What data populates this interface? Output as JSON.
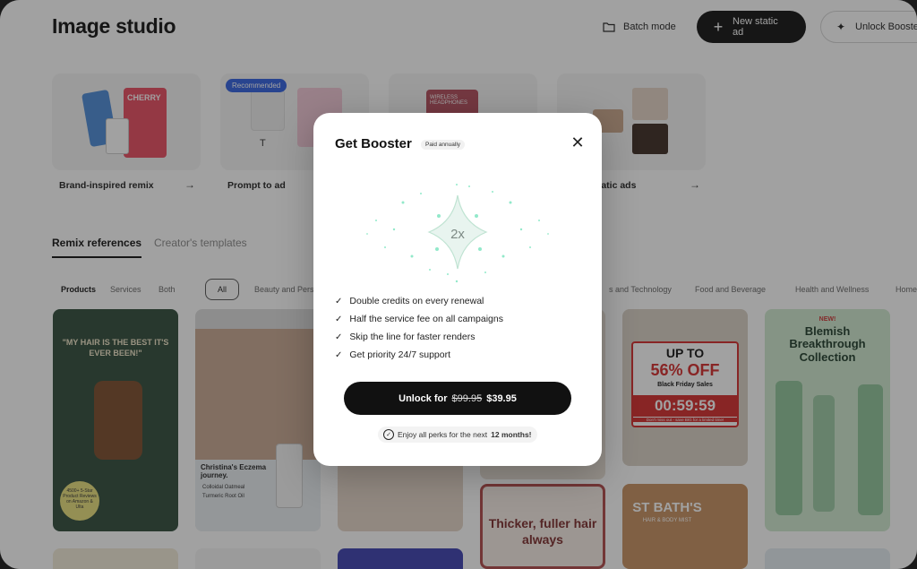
{
  "header": {
    "title": "Image studio",
    "batch_label": "Batch mode",
    "new_ad_label": "New static ad",
    "unlock_label": "Unlock Booster"
  },
  "features": [
    {
      "label": "Brand-inspired remix",
      "thumb_text": "CHERRY"
    },
    {
      "label": "Prompt to ad",
      "badge": "Recommended"
    },
    {
      "label": "",
      "thumb_text": "WIRELESS HEADPHONES"
    },
    {
      "label": "static ads"
    }
  ],
  "tabs": {
    "active": "Remix references",
    "inactive": "Creator's templates"
  },
  "filters": {
    "types": [
      "Products",
      "Services",
      "Both"
    ],
    "all": "All",
    "categories": [
      "Beauty and Pers",
      "s and Technology",
      "Food and Beverage",
      "Health and Wellness",
      "Home"
    ]
  },
  "cards": {
    "hair_quote": "\"MY HAIR IS THE BEST IT'S EVER BEEN!\"",
    "hair_badge": "4500+ 5-Star Product Reviews on Amazon & Ulta",
    "eczema_title": "Christina's Eczema journey.",
    "eczema_items": [
      "Colloidal Oatmeal",
      "Turmeric Root Oil"
    ],
    "bf_up": "UP TO",
    "bf_off": "56% OFF",
    "bf_sale": "Black Friday Sales",
    "bf_timer": "00:59:59",
    "bf_note": "Don't miss out - save BIG for a limited time!",
    "blemish_new": "NEW!",
    "blemish_title": "Blemish Breakthrough Collection",
    "thicker": "Thicker, fuller hair always",
    "bath": "ST BATH'S",
    "bath_sub": "HAIR & BODY MIST"
  },
  "modal": {
    "title": "Get Booster",
    "badge": "Paid annually",
    "multiplier": "2x",
    "perks": [
      "Double credits on every renewal",
      "Half the service fee on all campaigns",
      "Skip the line for faster renders",
      "Get priority 24/7 support"
    ],
    "cta_prefix": "Unlock for",
    "old_price": "$99.95",
    "new_price": "$39.95",
    "note_prefix": "Enjoy all perks for the next",
    "note_bold": "12 months!"
  },
  "colors": {
    "accent": "#111111",
    "recommended": "#2f5fe0",
    "sparkle": "#3ad8a0",
    "sale_red": "#d52a2a"
  }
}
